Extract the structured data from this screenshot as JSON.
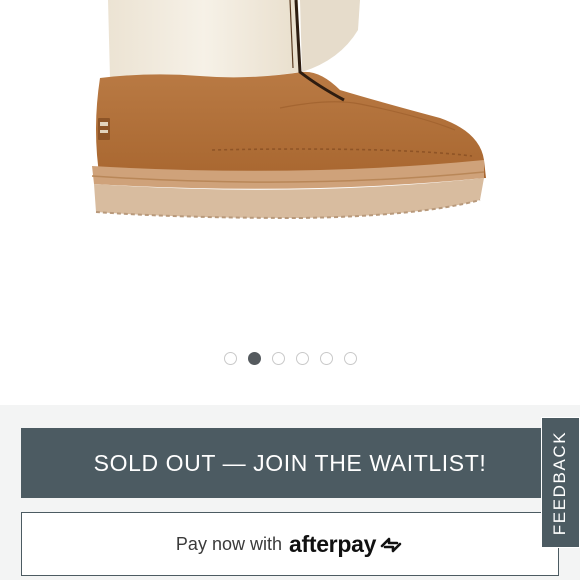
{
  "product": {
    "image_alt": "Suede boot with shearling cuff and front zipper",
    "carousel": {
      "total_slides": 6,
      "active_index": 1
    }
  },
  "actions": {
    "sold_out_label": "SOLD OUT — JOIN THE WAITLIST!",
    "pay_label": "Pay now with",
    "afterpay_brand": "afterpay"
  },
  "feedback_label": "FEEDBACK",
  "colors": {
    "button_slate": "#4c5b62",
    "panel_bg": "#f3f4f4",
    "boot_chestnut": "#b5733c",
    "shearling_cream": "#f1ebdf",
    "sole_tan": "#d3b597"
  }
}
